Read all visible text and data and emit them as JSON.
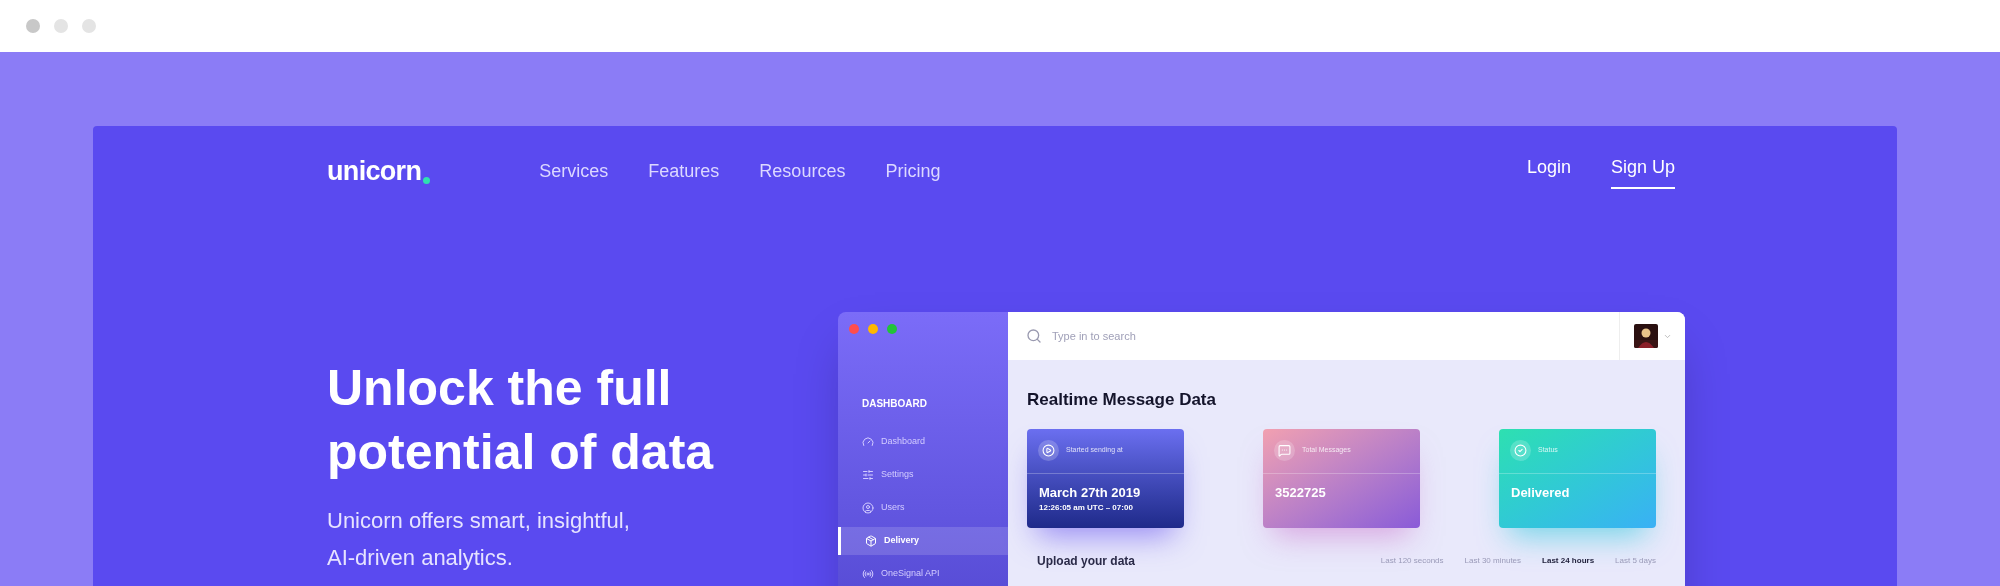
{
  "site": {
    "logo": "unicorn",
    "nav": [
      {
        "label": "Services"
      },
      {
        "label": "Features"
      },
      {
        "label": "Resources"
      },
      {
        "label": "Pricing"
      }
    ],
    "auth": [
      {
        "label": "Login",
        "selected": false
      },
      {
        "label": "Sign Up",
        "selected": true
      }
    ]
  },
  "hero": {
    "title_lines": [
      "Unlock the full",
      "potential of data"
    ],
    "subtitle_lines": [
      "Unicorn offers smart, insightful,",
      "AI-driven analytics."
    ]
  },
  "app": {
    "sidebar": {
      "heading": "DASHBOARD",
      "items": [
        {
          "label": "Dashboard",
          "selected": false
        },
        {
          "label": "Settings",
          "selected": false
        },
        {
          "label": "Users",
          "selected": false
        },
        {
          "label": "Delivery",
          "selected": true
        },
        {
          "label": "OneSignal API",
          "selected": false
        }
      ]
    },
    "search": {
      "placeholder": "Type in to search"
    },
    "title": "Realtime Message Data",
    "cards": [
      {
        "kind": "date",
        "label": "Started sending at",
        "value": "March 27th 2019",
        "detail": "12:26:05 am UTC – 07:00"
      },
      {
        "kind": "count",
        "label": "Total Messages",
        "value": "3522725"
      },
      {
        "kind": "status",
        "label": "Status",
        "value": "Delivered"
      }
    ],
    "upload": {
      "title": "Upload your data",
      "ranges": [
        {
          "label": "Last 120 seconds",
          "selected": false
        },
        {
          "label": "Last 30 minutes",
          "selected": false
        },
        {
          "label": "Last 24 hours",
          "selected": true
        },
        {
          "label": "Last 5 days",
          "selected": false
        }
      ]
    }
  }
}
